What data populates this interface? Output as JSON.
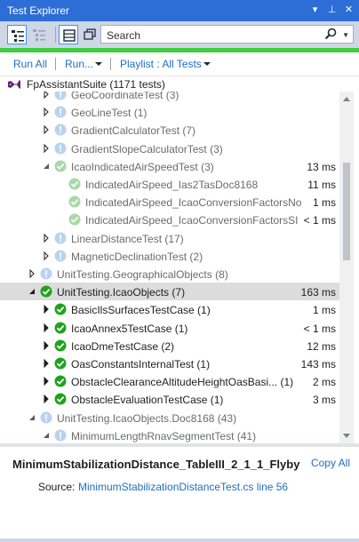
{
  "window": {
    "title": "Test Explorer",
    "controls": [
      "▾",
      "⊥",
      "✕"
    ]
  },
  "toolbar": {
    "search_placeholder": "Search"
  },
  "actions": {
    "run_all": "Run All",
    "run": "Run...",
    "playlist": "Playlist : All Tests"
  },
  "suite": {
    "name": "FpAssistantSuite (1171 tests)"
  },
  "tree": [
    {
      "label": "GeoCoordinateTest (3)",
      "indent": 2,
      "expander": "collapsed",
      "status": "info",
      "duration": "",
      "dim": true
    },
    {
      "label": "GeoLineTest (1)",
      "indent": 2,
      "expander": "collapsed",
      "status": "info",
      "duration": "",
      "dim": true
    },
    {
      "label": "GradientCalculatorTest (7)",
      "indent": 2,
      "expander": "collapsed",
      "status": "info",
      "duration": "",
      "dim": true
    },
    {
      "label": "GradientSlopeCalculatorTest (3)",
      "indent": 2,
      "expander": "collapsed",
      "status": "info",
      "duration": "",
      "dim": true
    },
    {
      "label": "IcaoIndicatedAirSpeedTest (3)",
      "indent": 2,
      "expander": "expanded",
      "status": "pass-light",
      "duration": "13 ms",
      "dim": true
    },
    {
      "label": "IndicatedAirSpeed_Ias2TasDoc8168",
      "indent": 3,
      "expander": "none",
      "status": "pass-light",
      "duration": "11 ms",
      "dim": true
    },
    {
      "label": "IndicatedAirSpeed_IcaoConversionFactorsNo...",
      "indent": 3,
      "expander": "none",
      "status": "pass-light",
      "duration": "1 ms",
      "dim": true
    },
    {
      "label": "IndicatedAirSpeed_IcaoConversionFactorsSI",
      "indent": 3,
      "expander": "none",
      "status": "pass-light",
      "duration": "< 1 ms",
      "dim": true
    },
    {
      "label": "LinearDistanceTest (17)",
      "indent": 2,
      "expander": "collapsed",
      "status": "info",
      "duration": "",
      "dim": true
    },
    {
      "label": "MagneticDeclinationTest (2)",
      "indent": 2,
      "expander": "collapsed",
      "status": "info",
      "duration": "",
      "dim": true
    },
    {
      "label": "UnitTesting.GeographicalObjects (8)",
      "indent": 1,
      "expander": "collapsed",
      "status": "info",
      "duration": "",
      "dim": true
    },
    {
      "label": "UnitTesting.IcaoObjects (7)",
      "indent": 1,
      "expander": "expanded-dark",
      "status": "pass",
      "duration": "163 ms",
      "dim": false,
      "selected": true
    },
    {
      "label": "BasicIlsSurfacesTestCase (1)",
      "indent": 2,
      "expander": "collapsed-dark",
      "status": "pass",
      "duration": "1 ms",
      "dim": false
    },
    {
      "label": "IcaoAnnex5TestCase (1)",
      "indent": 2,
      "expander": "collapsed-dark",
      "status": "pass",
      "duration": "< 1 ms",
      "dim": false
    },
    {
      "label": "IcaoDmeTestCase (2)",
      "indent": 2,
      "expander": "collapsed-dark",
      "status": "pass",
      "duration": "12 ms",
      "dim": false
    },
    {
      "label": "OasConstantsInternalTest (1)",
      "indent": 2,
      "expander": "collapsed-dark",
      "status": "pass",
      "duration": "143 ms",
      "dim": false
    },
    {
      "label": "ObstacleClearanceAltitudeHeightOasBasi... (1)",
      "indent": 2,
      "expander": "collapsed-dark",
      "status": "pass",
      "duration": "2 ms",
      "dim": false
    },
    {
      "label": "ObstacleEvaluationTestCase (1)",
      "indent": 2,
      "expander": "collapsed-dark",
      "status": "pass",
      "duration": "3 ms",
      "dim": false
    },
    {
      "label": "UnitTesting.IcaoObjects.Doc8168 (43)",
      "indent": 1,
      "expander": "expanded",
      "status": "info",
      "duration": "",
      "dim": true
    },
    {
      "label": "MinimumLengthRnavSegmentTest (41)",
      "indent": 2,
      "expander": "expanded",
      "status": "info",
      "duration": "",
      "dim": true
    }
  ],
  "details": {
    "test_name": "MinimumStabilizationDistance_TableIII_2_1_1_Flyby",
    "copy_all": "Copy All",
    "source_label": "Source:",
    "source_link": "MinimumStabilizationDistanceTest.cs line 56"
  },
  "colors": {
    "accent": "#2d6ed6",
    "pass": "#1fa31f",
    "pass_light": "#a9d8a9",
    "info": "#b9d3ef",
    "link": "#1e6fbf",
    "progress": "#3dcd3d"
  }
}
